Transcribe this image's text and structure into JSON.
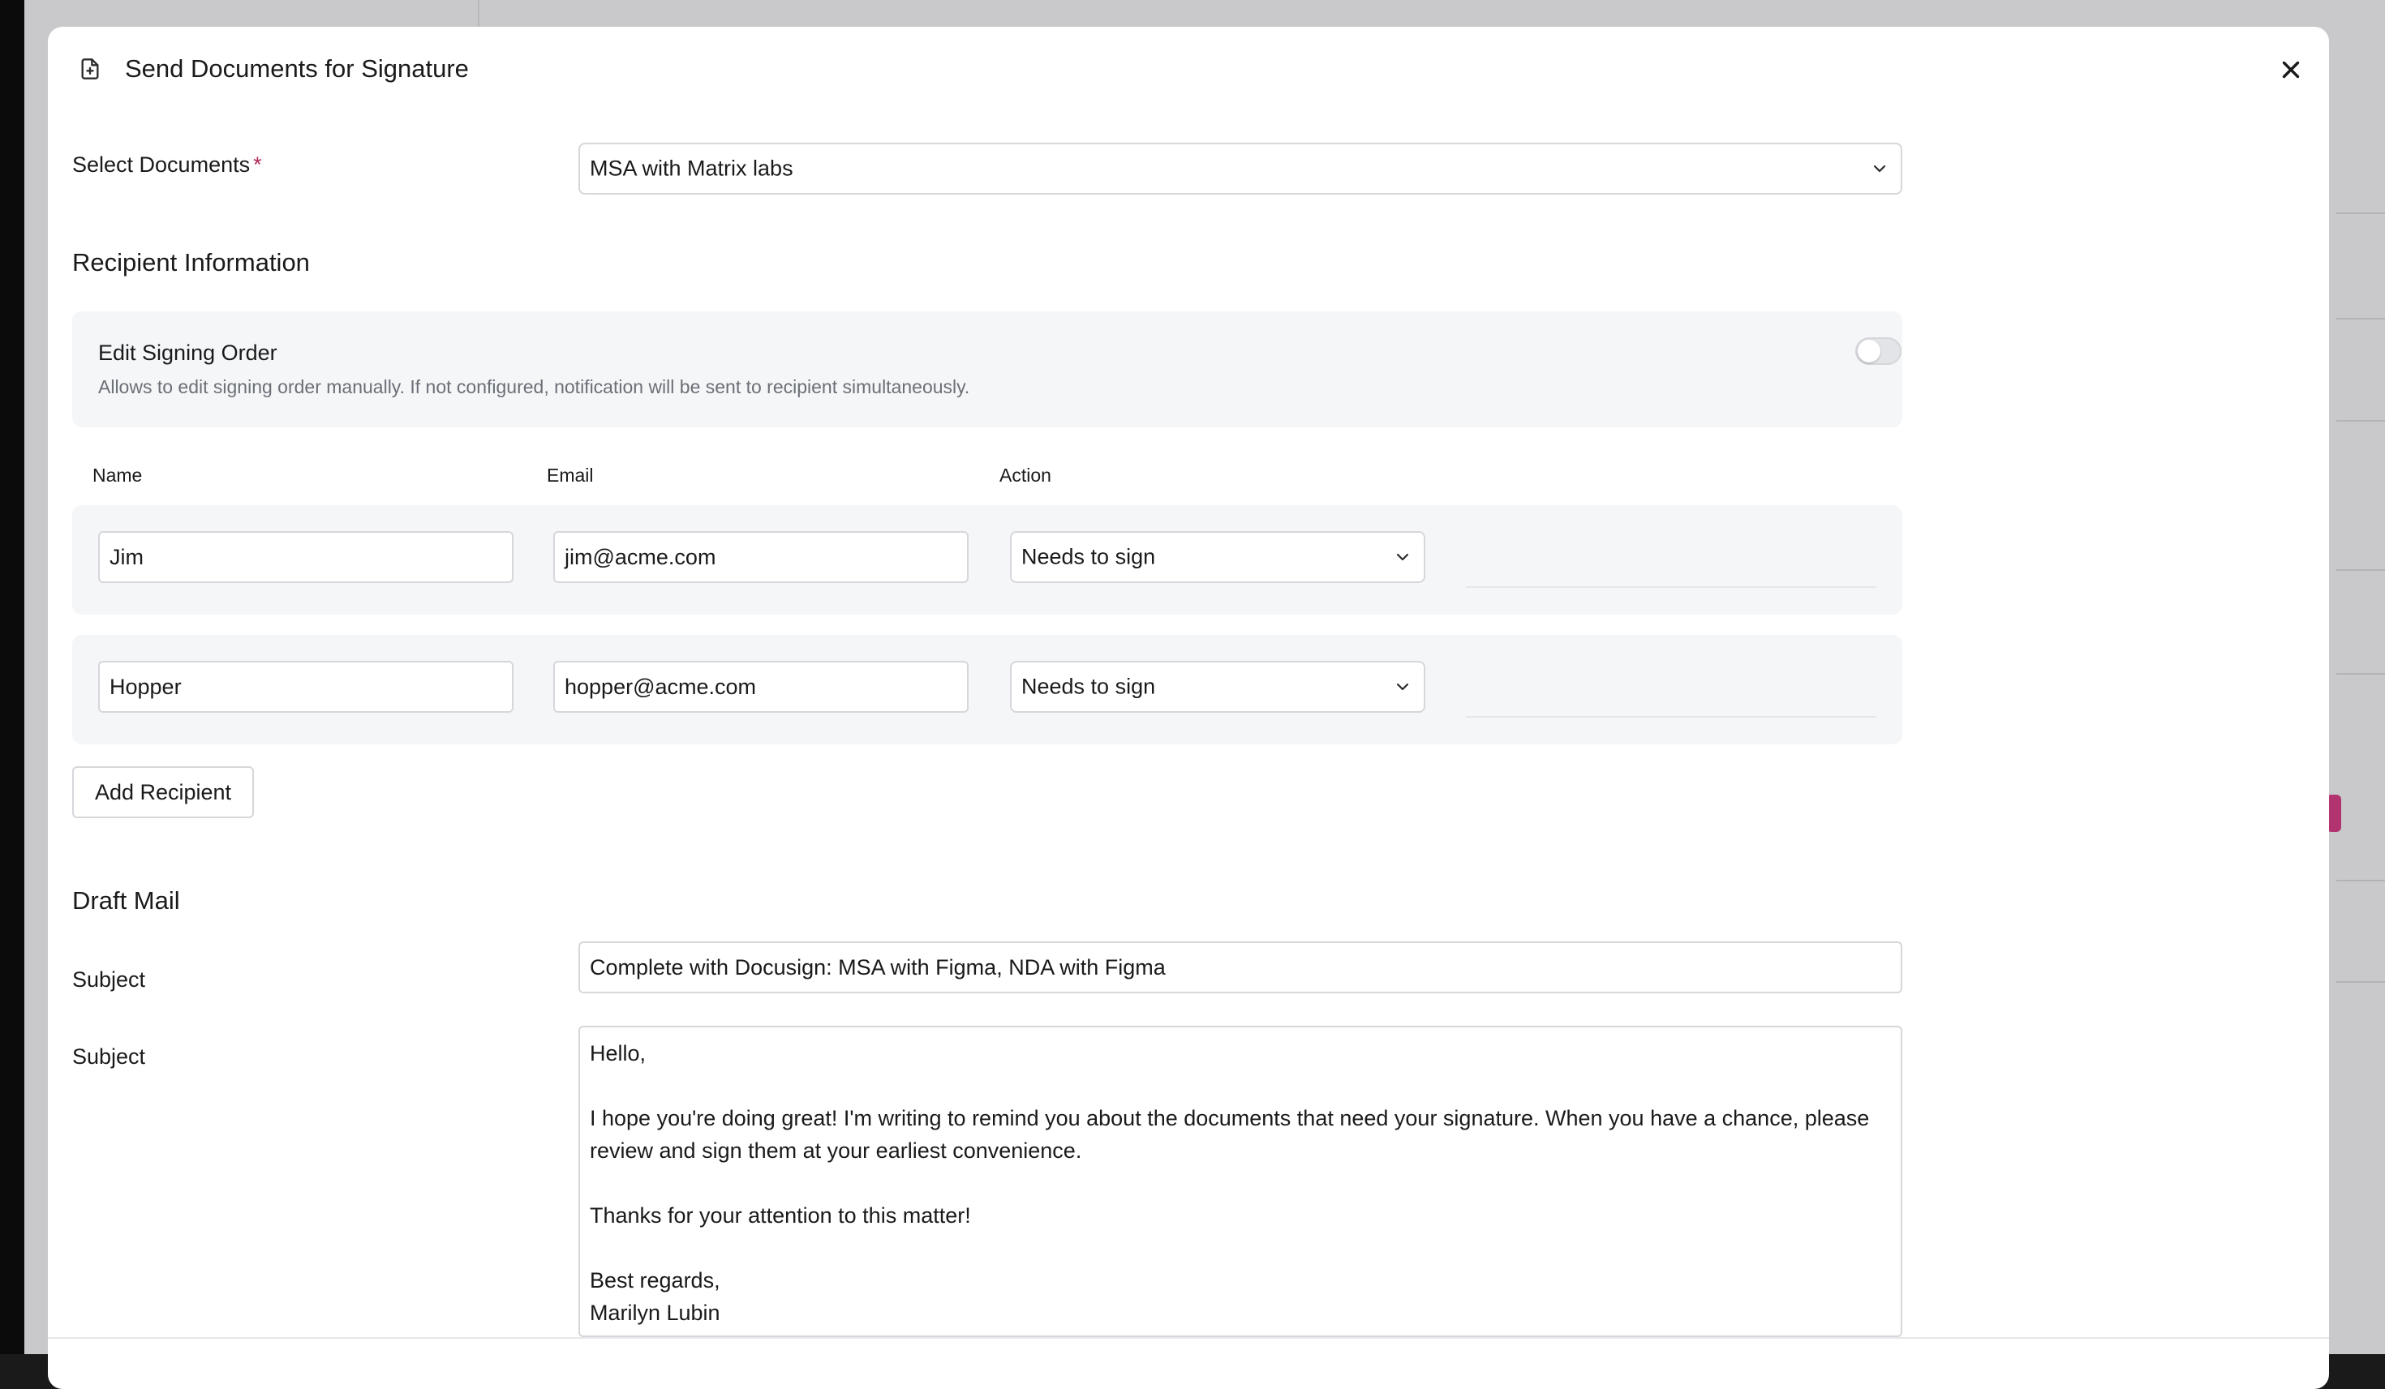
{
  "modal": {
    "title": "Send Documents for Signature",
    "select_documents": {
      "label": "Select Documents",
      "required_mark": "*",
      "value": "MSA with Matrix labs"
    }
  },
  "recipients": {
    "section_title": "Recipient Information",
    "signing_order": {
      "title": "Edit Signing Order",
      "description": "Allows to edit signing order manually. If not configured, notification will be sent to recipient simultaneously.",
      "enabled": false
    },
    "columns": [
      "Name",
      "Email",
      "Action"
    ],
    "rows": [
      {
        "name": "Jim",
        "email": "jim@acme.com",
        "action": "Needs to sign"
      },
      {
        "name": "Hopper",
        "email": "hopper@acme.com",
        "action": "Needs to sign"
      }
    ],
    "add_button": "Add Recipient"
  },
  "draft_mail": {
    "section_title": "Draft Mail",
    "subject_label": "Subject",
    "subject_value": "Complete with Docusign: MSA with Figma, NDA with Figma",
    "body_label": "Subject",
    "body_value": "Hello,\n\nI hope you're doing great! I'm writing to remind you about the documents that need your signature. When you have a chance, please review and sign them at your earliest convenience.\n\nThanks for your attention to this matter!\n\nBest regards,\nMarilyn Lubin"
  },
  "colors": {
    "required": "#b22a54",
    "card_bg": "#f5f6f8",
    "border": "#d7d7db"
  },
  "icons": {
    "title_icon": "document-plus-icon",
    "close_icon": "close-icon",
    "dropdown_icon": "chevron-down-icon"
  }
}
